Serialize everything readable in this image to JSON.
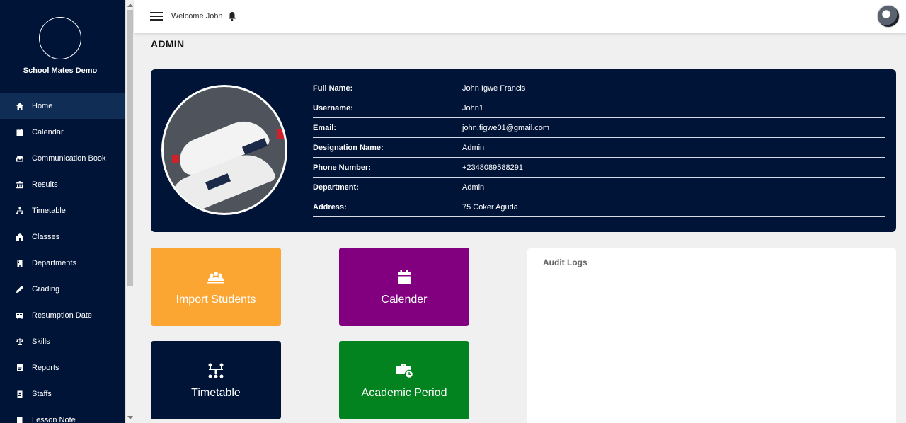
{
  "sidebar": {
    "school_name": "School Mates Demo",
    "items": [
      {
        "label": "Home",
        "icon": "home-icon",
        "active": true
      },
      {
        "label": "Calendar",
        "icon": "calendar-icon"
      },
      {
        "label": "Communication Book",
        "icon": "inbox-icon"
      },
      {
        "label": "Results",
        "icon": "bank-icon"
      },
      {
        "label": "Timetable",
        "icon": "sitemap-icon"
      },
      {
        "label": "Classes",
        "icon": "school-icon"
      },
      {
        "label": "Departments",
        "icon": "building-icon"
      },
      {
        "label": "Grading",
        "icon": "pen-icon"
      },
      {
        "label": "Resumption Date",
        "icon": "bus-icon"
      },
      {
        "label": "Skills",
        "icon": "scale-icon"
      },
      {
        "label": "Reports",
        "icon": "report-icon"
      },
      {
        "label": "Staffs",
        "icon": "id-badge-icon"
      },
      {
        "label": "Lesson Note",
        "icon": "book-icon"
      }
    ]
  },
  "topbar": {
    "welcome": "Welcome John"
  },
  "page": {
    "title": "ADMIN"
  },
  "profile": {
    "rows": [
      {
        "key": "Full Name:",
        "value": "John Igwe Francis"
      },
      {
        "key": "Username:",
        "value": "John1"
      },
      {
        "key": "Email:",
        "value": "john.figwe01@gmail.com"
      },
      {
        "key": "Designation Name:",
        "value": "Admin"
      },
      {
        "key": "Phone Number:",
        "value": "+2348089588291"
      },
      {
        "key": "Department:",
        "value": "Admin"
      },
      {
        "key": "Address:",
        "value": "75 Coker Aguda"
      }
    ]
  },
  "tiles": [
    {
      "label": "Import Students",
      "icon": "users-icon",
      "color": "#fba632"
    },
    {
      "label": "Calender",
      "icon": "calendar-icon",
      "color": "#820080"
    },
    {
      "label": "Timetable",
      "icon": "sitemap-icon",
      "color": "#001438"
    },
    {
      "label": "Academic Period",
      "icon": "briefcase-clock-icon",
      "color": "#03831f"
    }
  ],
  "audit": {
    "title": "Audit Logs"
  },
  "colors": {
    "sidebar_bg": "#001438",
    "sidebar_active": "#0f2d55",
    "page_bg": "#f0f0f0"
  }
}
